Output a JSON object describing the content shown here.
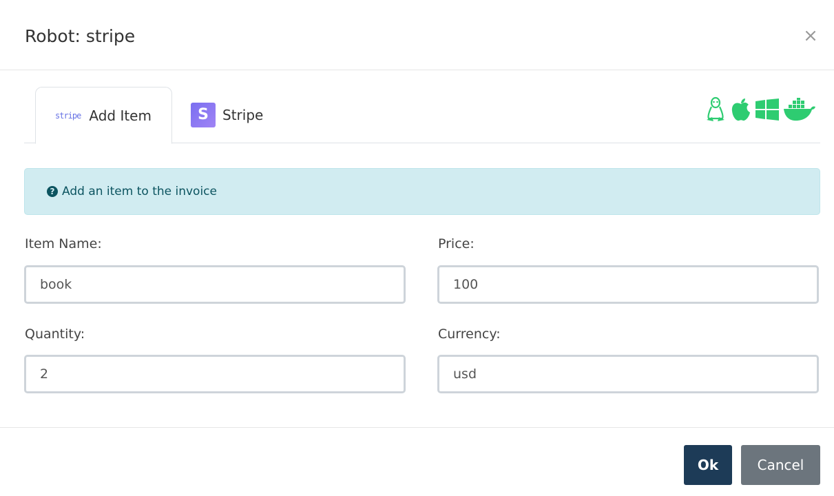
{
  "dialog": {
    "title": "Robot: stripe",
    "close_glyph": "×"
  },
  "tabs": [
    {
      "label": "Add Item",
      "icon": "stripe-wordmark-icon",
      "icon_text": "stripe",
      "active": true
    },
    {
      "label": "Stripe",
      "icon": "stripe-s-icon",
      "icon_text": "S",
      "active": false
    }
  ],
  "platform_icons": [
    "linux-icon",
    "apple-icon",
    "windows-icon",
    "docker-icon"
  ],
  "colors": {
    "platform_icon": "#2ecc71",
    "ok_button": "#1d3b57",
    "cancel_button": "#6c757d",
    "alert_bg": "#d1ecf1",
    "alert_text": "#0c5460"
  },
  "alert": {
    "icon": "question-circle-icon",
    "text": "Add an item to the invoice"
  },
  "form": {
    "item_name": {
      "label": "Item Name:",
      "value": "book"
    },
    "price": {
      "label": "Price:",
      "value": "100"
    },
    "quantity": {
      "label": "Quantity:",
      "value": "2"
    },
    "currency": {
      "label": "Currency:",
      "value": "usd"
    }
  },
  "footer": {
    "ok_label": "Ok",
    "cancel_label": "Cancel"
  }
}
